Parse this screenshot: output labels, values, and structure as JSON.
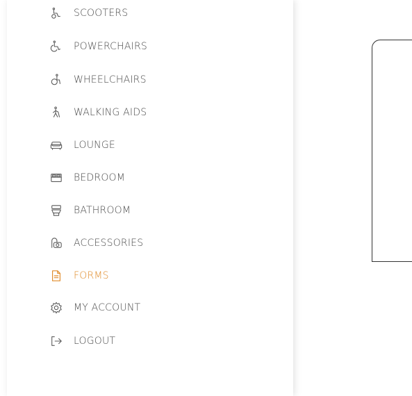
{
  "sidebar": {
    "items": [
      {
        "label": "SCOOTERS",
        "icon": "scooter-icon"
      },
      {
        "label": "POWERCHAIRS",
        "icon": "powerchair-icon"
      },
      {
        "label": "WHEELCHAIRS",
        "icon": "wheelchair-icon"
      },
      {
        "label": "WALKING AIDS",
        "icon": "walking-aid-icon"
      },
      {
        "label": "LOUNGE",
        "icon": "sofa-icon"
      },
      {
        "label": "BEDROOM",
        "icon": "bed-icon"
      },
      {
        "label": "BATHROOM",
        "icon": "toilet-icon"
      },
      {
        "label": "ACCESSORIES",
        "icon": "accessories-icon"
      },
      {
        "label": "FORMS",
        "icon": "document-icon",
        "active": true
      },
      {
        "label": "MY ACCOUNT",
        "icon": "gear-icon"
      },
      {
        "label": "LOGOUT",
        "icon": "logout-icon"
      }
    ]
  },
  "colors": {
    "text": "#4a4a4a",
    "active": "#e08b2a",
    "icon": "#5a5a5a"
  }
}
